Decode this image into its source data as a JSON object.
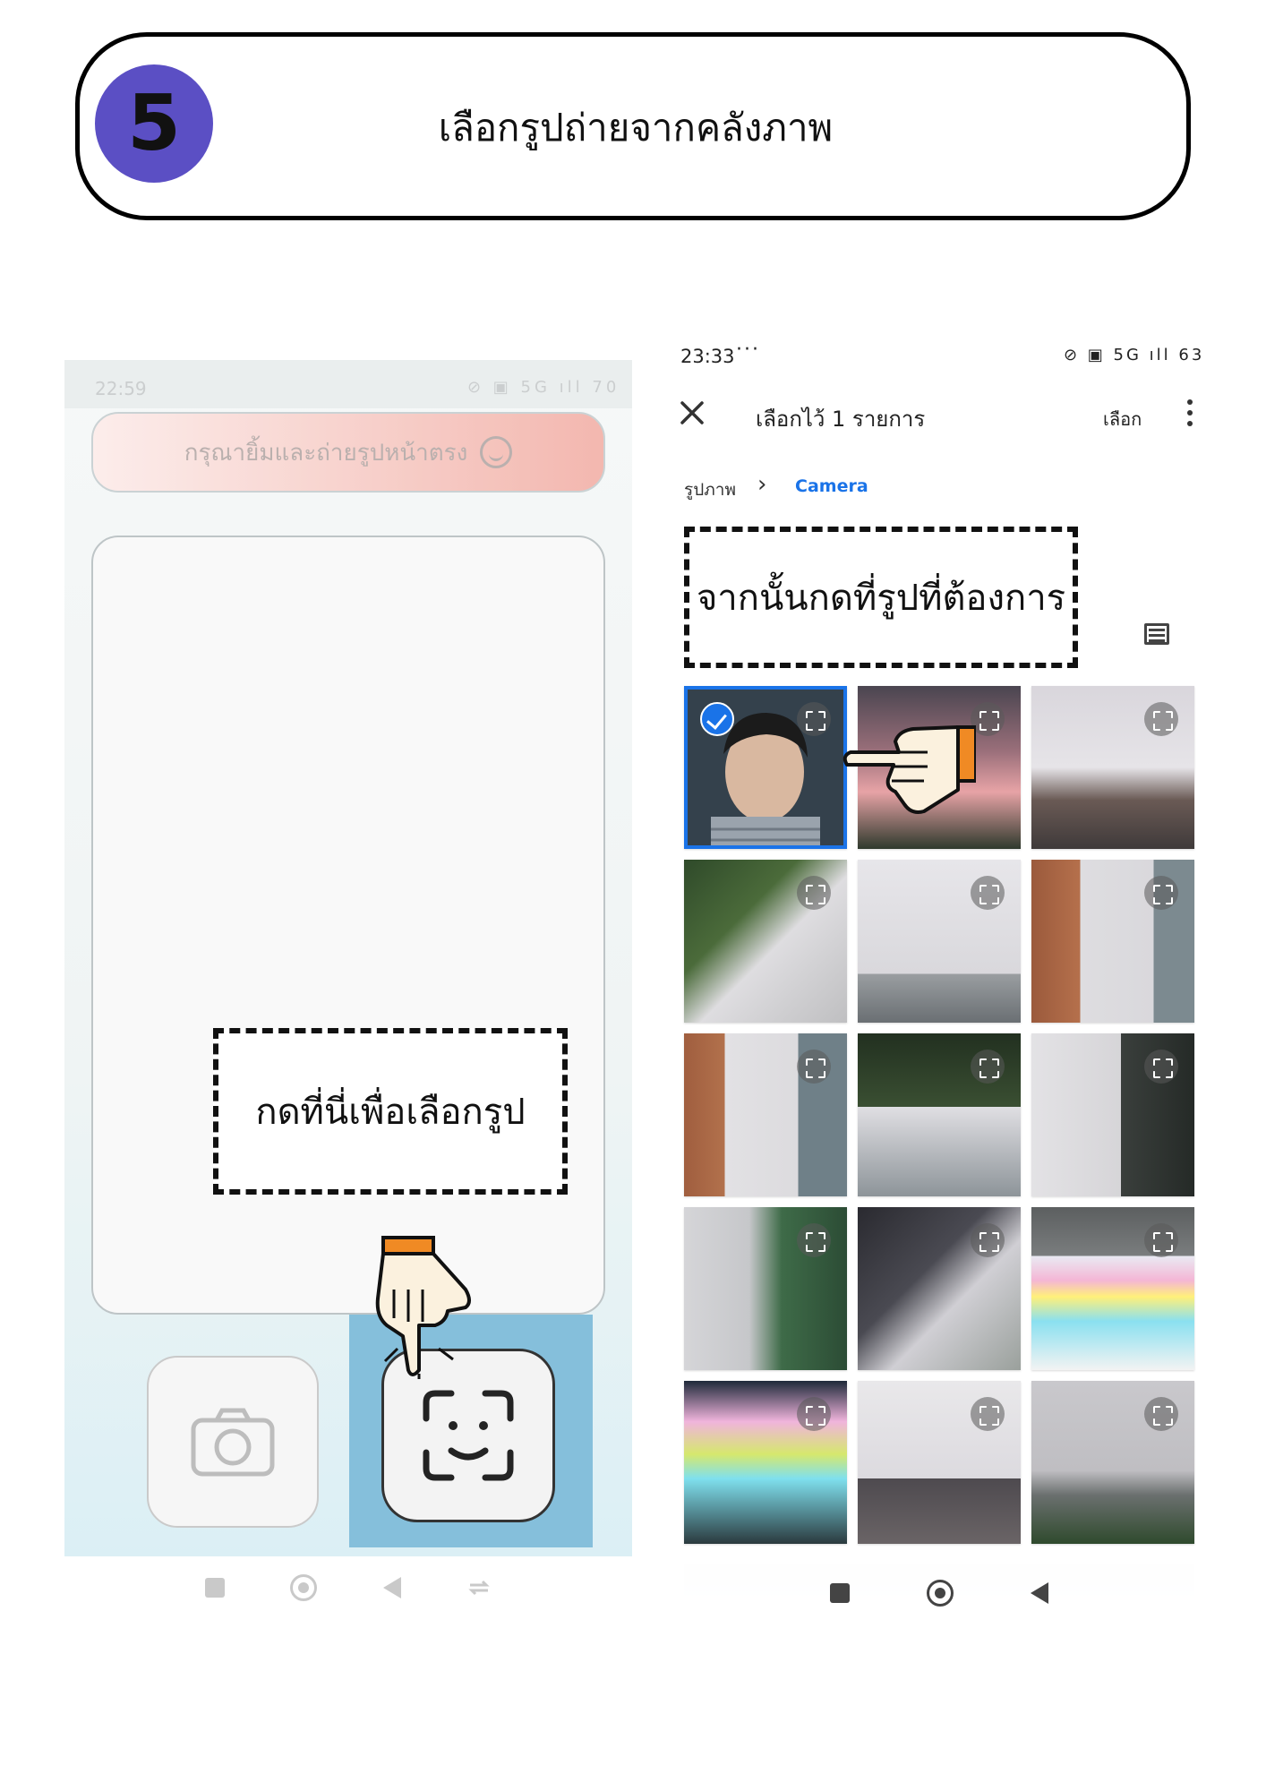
{
  "step": {
    "number": "5",
    "title": "เลือกรูปถ่ายจากคลังภาพ"
  },
  "left_screen": {
    "time": "22:59",
    "status_icons": "⊘ ▣ 5G ıll 70",
    "banner_text": "กรุณายิ้มและถ่ายรูปหน้าตรง",
    "callout": "กดที่นี่เพื่อเลือกรูป",
    "buttons": {
      "camera": "camera-icon",
      "face": "face-scan-icon"
    }
  },
  "right_screen": {
    "time": "23:33",
    "dots": "···",
    "status_icons": "⊘ ▣ 5G ıll 63",
    "selection_title": "เลือกไว้ 1 รายการ",
    "select_action": "เลือก",
    "breadcrumb": {
      "root": "รูปภาพ",
      "current": "Camera"
    },
    "callout": "จากนั้นกดที่รูปที่ต้องการ",
    "photos": [
      {
        "kind": "selfie",
        "selected": true
      },
      {
        "kind": "pink-sky-wires"
      },
      {
        "kind": "antenna-roof"
      },
      {
        "kind": "leaves-building"
      },
      {
        "kind": "building-sky"
      },
      {
        "kind": "tower-wires"
      },
      {
        "kind": "tower-wires-2"
      },
      {
        "kind": "leaves-tower"
      },
      {
        "kind": "highrise"
      },
      {
        "kind": "street-lamps"
      },
      {
        "kind": "wires-sky"
      },
      {
        "kind": "board"
      },
      {
        "kind": "board-2"
      },
      {
        "kind": "light-pole"
      },
      {
        "kind": "skyline"
      }
    ]
  },
  "colors": {
    "badge": "#5b4fc4",
    "accent_blue": "#1a73e8",
    "hand_cuff": "#f08a24"
  }
}
